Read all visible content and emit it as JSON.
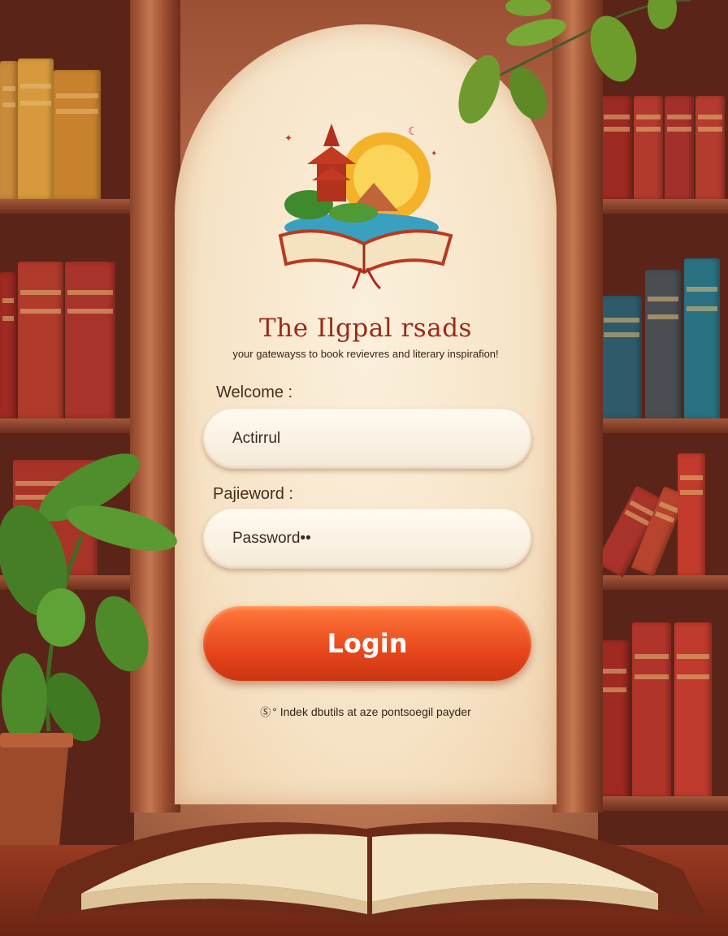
{
  "app": {
    "title": "The Ilgpal rsads",
    "tagline": "your gatewayss to book revievres and literary inspirafion!"
  },
  "form": {
    "welcome_label": "Welcome :",
    "username_value": "Actirrul",
    "password_label": "Pajieword :",
    "password_value": "Password••",
    "login_label": "Login"
  },
  "footer": {
    "symbol": "Ⓢ",
    "note": "° Indek dbutils at aze pontsoegil payder"
  },
  "icons": {
    "logo": "book-pagoda-sunset-logo",
    "footer_symbol": "copyright-icon"
  },
  "colors": {
    "accent": "#e8461c",
    "title": "#9b2a1c",
    "panel": "#f6e3c6"
  }
}
